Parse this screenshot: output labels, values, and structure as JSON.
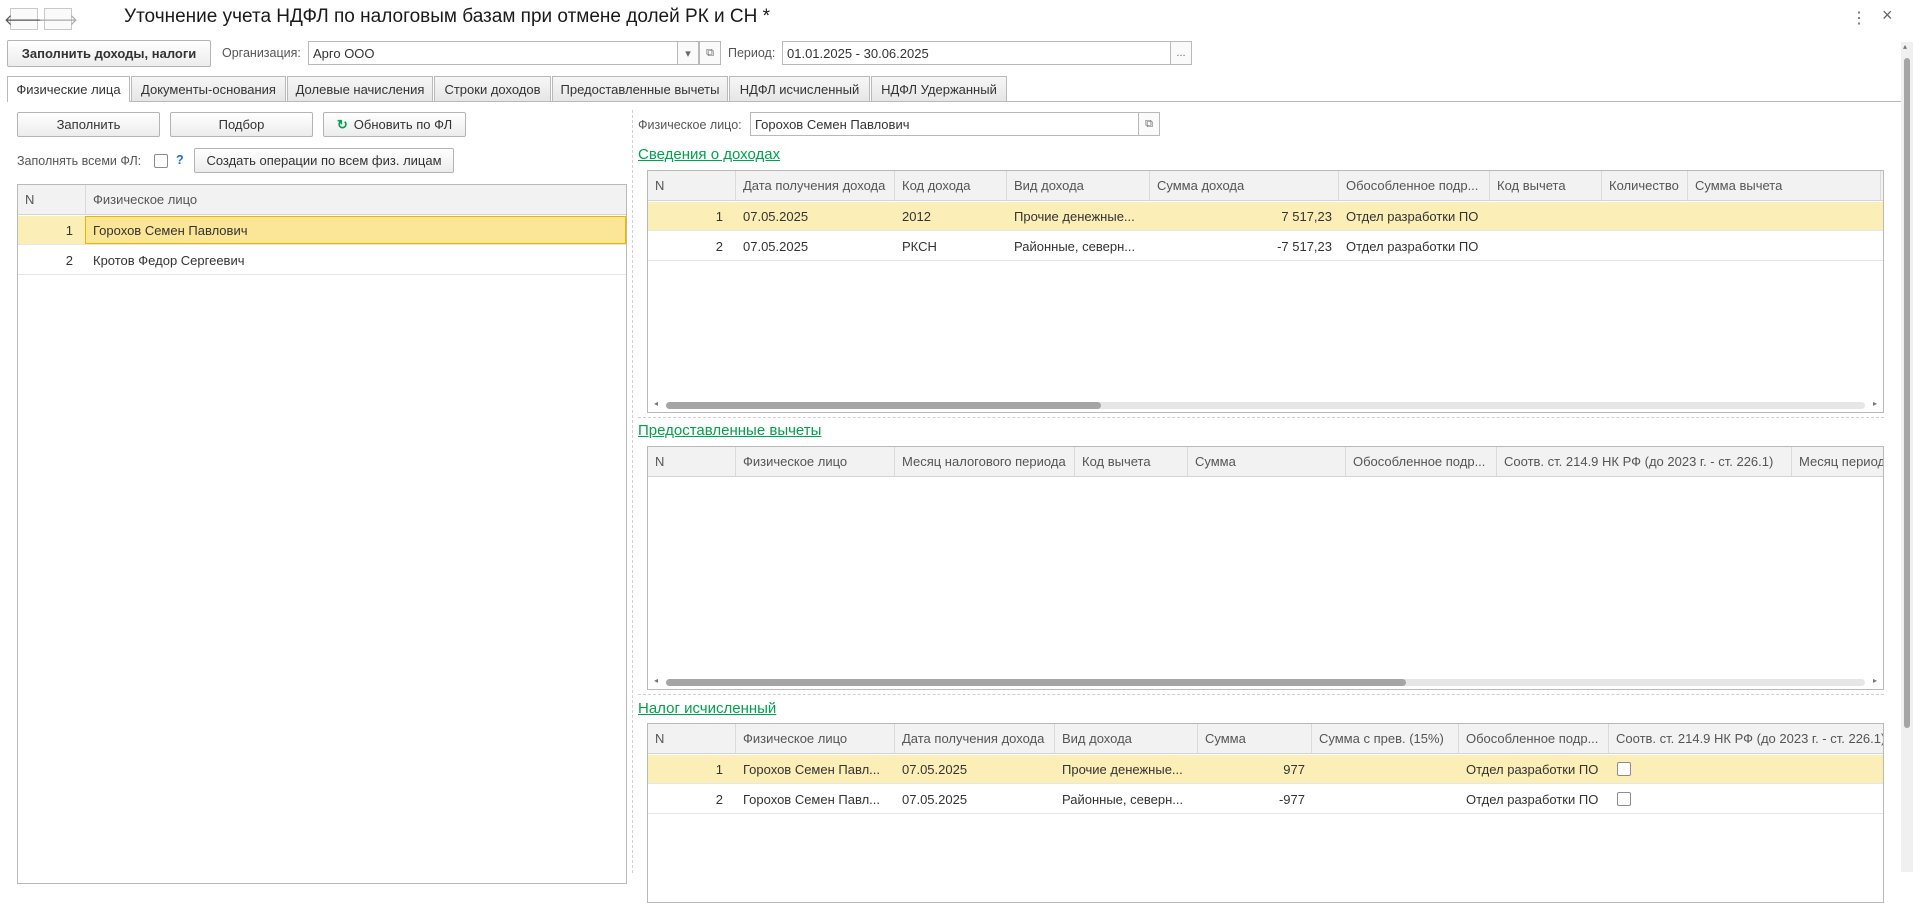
{
  "window": {
    "title": "Уточнение учета НДФЛ по налоговым базам при отмене долей РК и СН *",
    "back_icon": "arrow-left-icon",
    "forward_icon": "arrow-right-icon",
    "more_icon": "⋮",
    "close_icon": "×"
  },
  "toolbar": {
    "fill_button": "Заполнить доходы, налоги",
    "org_label": "Организация:",
    "org_value": "Арго ООО",
    "period_label": "Период:",
    "period_value": "01.01.2025 - 30.06.2025",
    "period_button": "..."
  },
  "tabs": [
    {
      "label": "Физические лица",
      "active": true
    },
    {
      "label": "Документы-основания"
    },
    {
      "label": "Долевые начисления"
    },
    {
      "label": "Строки доходов"
    },
    {
      "label": "Предоставленные вычеты"
    },
    {
      "label": "НДФЛ исчисленный"
    },
    {
      "label": "НДФЛ Удержанный"
    }
  ],
  "left": {
    "fill_button": "Заполнить",
    "select_button": "Подбор",
    "refresh_button": "Обновить по ФЛ",
    "fill_all_label": "Заполнять всеми ФЛ:",
    "help": "?",
    "create_ops_button": "Создать операции по всем физ. лицам",
    "columns": [
      "N",
      "Физическое лицо"
    ],
    "rows": [
      {
        "n": "1",
        "name": "Горохов Семен Павлович"
      },
      {
        "n": "2",
        "name": "Кротов Федор Сергеевич"
      }
    ]
  },
  "right": {
    "person_label": "Физическое лицо:",
    "person_value": "Горохов Семен Павлович",
    "income": {
      "title": "Сведения о доходах",
      "columns": [
        "N",
        "Дата получения дохода",
        "Код дохода",
        "Вид дохода",
        "Сумма дохода",
        "Обособленное подр...",
        "Код вычета",
        "Количество",
        "Сумма вычета"
      ],
      "rows": [
        [
          "1",
          "07.05.2025",
          "2012",
          "Прочие денежные...",
          "7 517,23",
          "Отдел разработки ПО",
          "",
          "",
          ""
        ],
        [
          "2",
          "07.05.2025",
          "РКСН",
          "Районные, северн...",
          "-7 517,23",
          "Отдел разработки ПО",
          "",
          "",
          ""
        ]
      ]
    },
    "deductions": {
      "title": "Предоставленные вычеты",
      "columns": [
        "N",
        "Физическое лицо",
        "Месяц налогового периода",
        "Код вычета",
        "Сумма",
        "Обособленное подр...",
        "Соотв. ст. 214.9 НК РФ (до 2023 г. - ст. 226.1)",
        "Месяц периода"
      ],
      "rows": []
    },
    "tax": {
      "title": "Налог исчисленный",
      "columns": [
        "N",
        "Физическое лицо",
        "Дата получения дохода",
        "Вид дохода",
        "Сумма",
        "Сумма с прев. (15%)",
        "Обособленное подр...",
        "Соотв. ст. 214.9 НК РФ (до 2023 г. - ст. 226.1)"
      ],
      "rows": [
        [
          "1",
          "Горохов Семен Павл...",
          "07.05.2025",
          "Прочие денежные...",
          "977",
          "",
          "Отдел разработки ПО"
        ],
        [
          "2",
          "Горохов Семен Павл...",
          "07.05.2025",
          "Районные, северн...",
          "-977",
          "",
          "Отдел разработки ПО"
        ]
      ]
    }
  },
  "colors": {
    "accent_green": "#00a24b",
    "selected_row": "#fbeeb7",
    "selected_cell": "#fbe596"
  }
}
